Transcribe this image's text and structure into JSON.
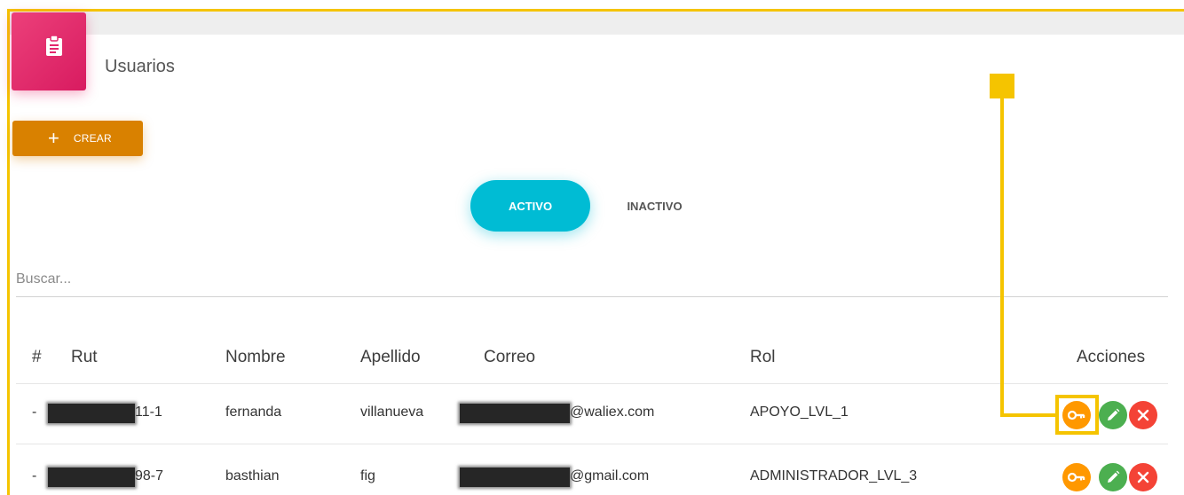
{
  "page": {
    "title": "Usuarios"
  },
  "toolbar": {
    "create_label": "CREAR",
    "create_icon": "plus-icon"
  },
  "tabs": [
    {
      "label": "ACTIVO",
      "active": true
    },
    {
      "label": "INACTIVO",
      "active": false
    }
  ],
  "search": {
    "placeholder": "Buscar...",
    "value": ""
  },
  "table": {
    "headers": [
      "#",
      "Rut",
      "Nombre",
      "Apellido",
      "Correo",
      "Rol",
      "Acciones"
    ],
    "rows": [
      {
        "num": "-",
        "rut_suffix": "11-1",
        "nombre": "fernanda",
        "apellido": "villanueva",
        "correo_suffix": "@waliex.com",
        "rol": "APOYO_LVL_1"
      },
      {
        "num": "-",
        "rut_suffix": "98-7",
        "nombre": "basthian",
        "apellido": "fig",
        "correo_suffix": "@gmail.com",
        "rol": "ADMINISTRADOR_LVL_3"
      }
    ]
  },
  "icons": {
    "header": "clipboard-icon",
    "actions": [
      "key-icon",
      "pencil-icon",
      "close-icon"
    ]
  },
  "colors": {
    "header_icon_bg": "#e91e63",
    "create_button": "#d98100",
    "active_tab": "#00bcd4",
    "key_action": "#ff9800",
    "edit_action": "#4caf50",
    "delete_action": "#f44336",
    "annotation": "#f5c400"
  }
}
